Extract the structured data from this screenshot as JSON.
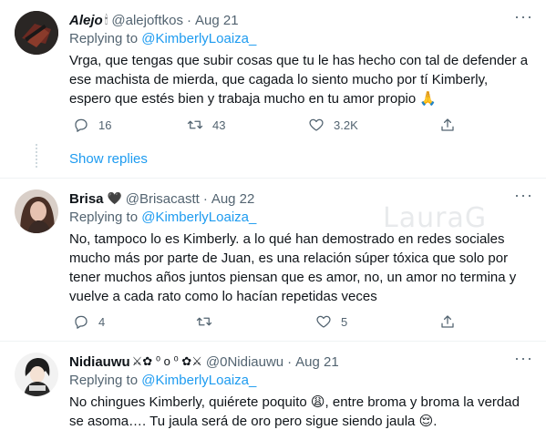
{
  "tweets": [
    {
      "name": "Alejo",
      "name_deco": "🕯",
      "handle": "@alejoftkos",
      "sep": "·",
      "date": "Aug 21",
      "reply_prefix": "Replying to ",
      "reply_to": "@KimberlyLoaiza_",
      "text": "Vrga, que tengas que subir cosas que tu le has hecho con tal de defender a ese machista de mierda, que cagada lo siento mucho por tí Kimberly, espero que estés bien y trabaja mucho en tu amor propio 🙏",
      "replies": "16",
      "retweets": "43",
      "likes": "3.2K",
      "show_replies": "Show replies"
    },
    {
      "name": "Brisa",
      "name_deco": "🖤",
      "handle": "@Brisacastt",
      "sep": "·",
      "date": "Aug 22",
      "reply_prefix": "Replying to ",
      "reply_to": "@KimberlyLoaiza_",
      "text": "No, tampoco lo es Kimberly. a lo qué han demostrado en redes sociales mucho más por parte de Juan, es una relación súper tóxica que solo por tener muchos años juntos piensan que es amor, no, un amor no termina y vuelve a cada rato como lo hacían repetidas veces",
      "replies": "4",
      "retweets": "",
      "likes": "5"
    },
    {
      "name": "Nidiauwu",
      "name_deco": "⚔✿ ⁰ o ⁰ ✿⚔",
      "handle": "@0Nidiauwu",
      "sep": "·",
      "date": "Aug 21",
      "reply_prefix": "Replying to ",
      "reply_to": "@KimberlyLoaiza_",
      "text_a": "No chingues Kimberly, quiérete poquito ",
      "emoji_a": "😩",
      "text_b": ", entre broma y broma la verdad se asoma…. Tu jaula será de oro pero sigue siendo jaula ",
      "emoji_b": "😌",
      "text_c": "."
    }
  ],
  "watermark": "LauraG",
  "more_glyph": "···",
  "colors": {
    "accent": "#1d9bf0",
    "muted": "#536471",
    "text": "#0f1419",
    "divider": "#eff3f4"
  }
}
